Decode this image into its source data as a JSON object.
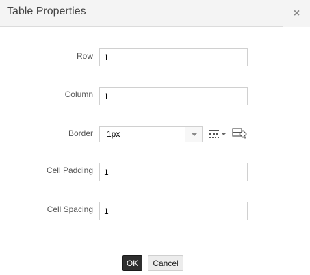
{
  "dialog": {
    "title": "Table Properties",
    "close_glyph": "×",
    "close_icon": "close-icon"
  },
  "fields": {
    "row": {
      "label": "Row",
      "value": "1"
    },
    "column": {
      "label": "Column",
      "value": "1"
    },
    "border": {
      "label": "Border",
      "value": "1px",
      "dropdown_icon": "chevron-down-icon",
      "style_icon": "border-style-icon",
      "color_icon": "border-color-fill-icon"
    },
    "cell_padding": {
      "label": "Cell Padding",
      "value": "1"
    },
    "cell_spacing": {
      "label": "Cell Spacing",
      "value": "1"
    }
  },
  "buttons": {
    "ok": "OK",
    "cancel": "Cancel"
  },
  "colors": {
    "ok_background": "#2e2e2e",
    "title_bar_background": "#f4f4f4"
  }
}
